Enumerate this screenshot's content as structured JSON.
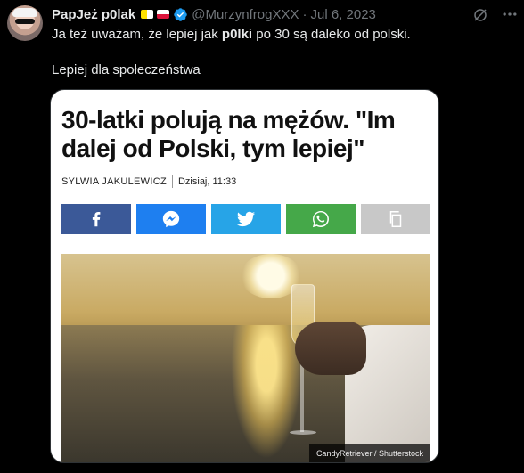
{
  "tweet": {
    "author_name": "PapJeż p0lak",
    "handle": "@MurzynfrogXXX",
    "date": "Jul 6, 2023",
    "separator": "·",
    "text_part1": "Ja też uważam, że lepiej jak ",
    "text_bold": "p0lki",
    "text_part2": " po 30 są daleko od polski.",
    "text_line2": "Lepiej dla społeczeństwa"
  },
  "article_card": {
    "title": "30-latki polują na mężów. \"Im dalej od Polski, tym lepiej\"",
    "author": "SYLWIA JAKULEWICZ",
    "time": "Dzisiaj, 11:33",
    "share_buttons": [
      {
        "name": "facebook",
        "icon": "facebook-icon",
        "color": "#3b5998"
      },
      {
        "name": "messenger",
        "icon": "messenger-icon",
        "color": "#1e7ff0"
      },
      {
        "name": "twitter",
        "icon": "twitter-icon",
        "color": "#27a4e7"
      },
      {
        "name": "whatsapp",
        "icon": "whatsapp-icon",
        "color": "#45a849"
      },
      {
        "name": "copy",
        "icon": "copy-icon",
        "color": "#c8c8c8"
      }
    ],
    "photo_credit": "CandyRetriever / Shutterstock"
  },
  "colors": {
    "background": "#000000",
    "text_primary": "#e7e9ea",
    "text_secondary": "#71767b",
    "verified": "#1d9bf0"
  }
}
